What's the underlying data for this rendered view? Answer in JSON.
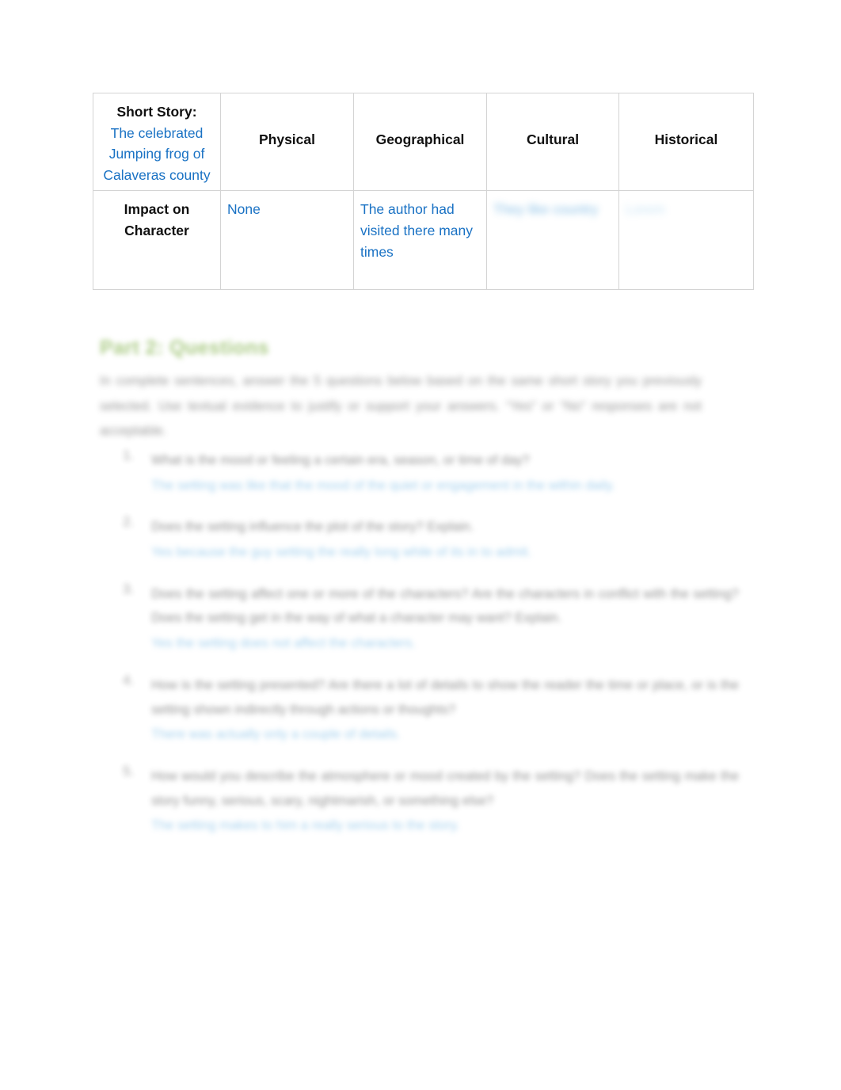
{
  "document": {
    "kind": "worksheet",
    "colors": {
      "answer_blue": "#1a72c4",
      "heading_green": "#8fba5e",
      "body_text": "#2d2d2d",
      "table_border": "#d4d4d4"
    }
  },
  "setting_table": {
    "title_cell": {
      "label": "Short Story:",
      "story_title": "The celebrated Jumping frog of Calaveras county"
    },
    "column_headers": [
      "Physical",
      "Geographical",
      "Cultural",
      "Historical"
    ],
    "row_label": "Impact on Character",
    "row_values": [
      {
        "column": "Physical",
        "text": "None",
        "obscured": false
      },
      {
        "column": "Geographical",
        "text": "The author had visited there many times",
        "obscured": false
      },
      {
        "column": "Cultural",
        "text": "They like country",
        "obscured": true
      },
      {
        "column": "Historical",
        "text": "Lorem",
        "obscured": true
      }
    ]
  },
  "part_section": {
    "heading": "Part 2: Questions",
    "intro": "In complete sentences, answer the 5 questions below based on the same short story you previously selected. Use textual evidence to justify or support your answers. “Yes” or “No” responses are not acceptable."
  },
  "questions": [
    {
      "number": "1.",
      "prompt": "What is the mood or feeling a certain era, season, or time of day?",
      "answer": "The setting was like that the mood of the quiet or engagement in the within daily."
    },
    {
      "number": "2.",
      "prompt": "Does the setting influence the plot of the story? Explain.",
      "answer": "Yes because the guy setting the really long while of its in to admit."
    },
    {
      "number": "3.",
      "prompt": "Does the setting affect one or more of the characters? Are the characters in conflict with the setting? Does the setting get in the way of what a character may want? Explain.",
      "answer": "Yes the setting does not affect the characters."
    },
    {
      "number": "4.",
      "prompt": "How is the setting presented?  Are there a lot of details to show the reader the time or place, or is the setting shown indirectly through actions or thoughts?",
      "answer": "There was actually only a couple of details."
    },
    {
      "number": "5.",
      "prompt": "How would you describe the atmosphere or mood created by the setting? Does the setting make the story funny, serious, scary, nightmarish, or something else?",
      "answer": "The setting makes to him a really serious to the story."
    }
  ]
}
